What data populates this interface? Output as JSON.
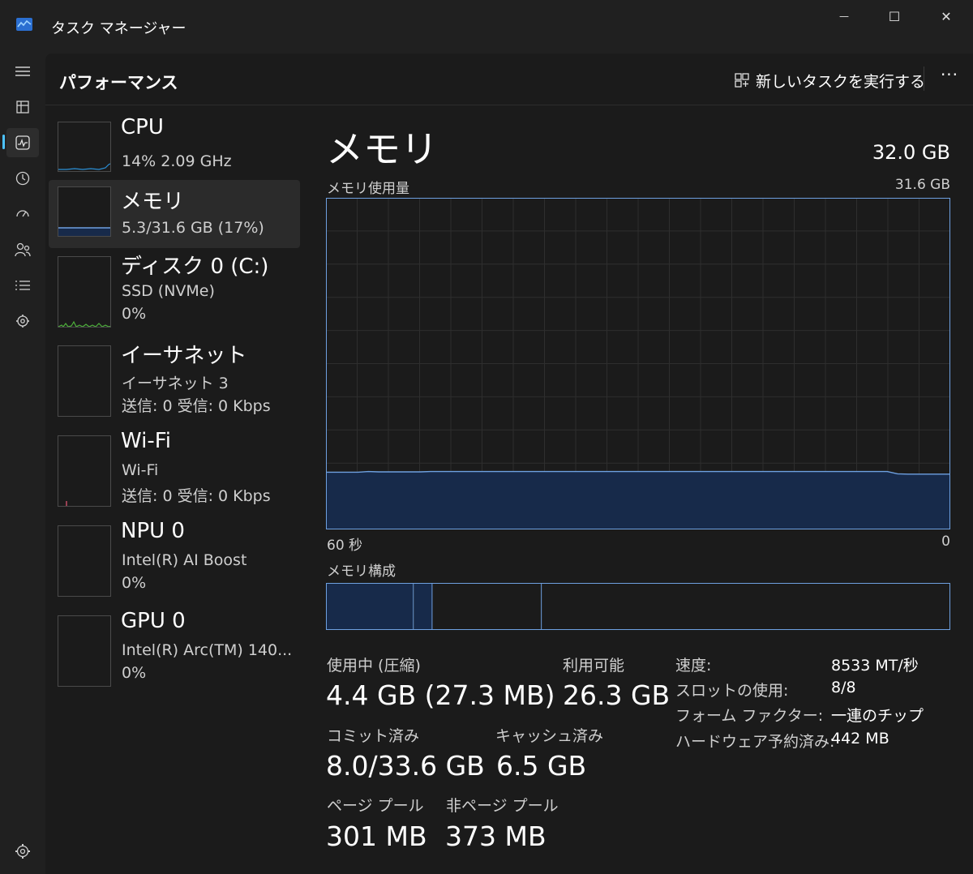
{
  "app": {
    "title": "タスク マネージャー"
  },
  "window_controls": {
    "minimize": "—",
    "maximize": "☐",
    "close": "✕"
  },
  "nav": {
    "items": [
      {
        "name": "menu-icon"
      },
      {
        "name": "processes-icon"
      },
      {
        "name": "performance-icon",
        "active": true
      },
      {
        "name": "app-history-icon"
      },
      {
        "name": "startup-apps-icon"
      },
      {
        "name": "users-icon"
      },
      {
        "name": "details-icon"
      },
      {
        "name": "services-icon"
      }
    ],
    "settings_icon": "settings-icon"
  },
  "header": {
    "title": "パフォーマンス",
    "run_task_label": "新しいタスクを実行する",
    "more_label": "···"
  },
  "resources": [
    {
      "name": "CPU",
      "sub1": "14% 2.09 GHz",
      "sub2": ""
    },
    {
      "name": "メモリ",
      "sub1": "5.3/31.6 GB (17%)",
      "sub2": "",
      "selected": true
    },
    {
      "name": "ディスク 0 (C:)",
      "sub1": "SSD (NVMe)",
      "sub2": "0%"
    },
    {
      "name": "イーサネット",
      "sub1": "イーサネット 3",
      "sub2": "送信: 0 受信: 0 Kbps"
    },
    {
      "name": "Wi-Fi",
      "sub1": "Wi-Fi",
      "sub2": "送信: 0 受信: 0 Kbps"
    },
    {
      "name": "NPU 0",
      "sub1": "Intel(R) AI Boost",
      "sub2": "0%"
    },
    {
      "name": "GPU 0",
      "sub1": "Intel(R) Arc(TM) 140...",
      "sub2": "0%"
    }
  ],
  "detail": {
    "title": "メモリ",
    "total": "32.0 GB",
    "usage_label": "メモリ使用量",
    "usage_max": "31.6 GB",
    "axis_left": "60 秒",
    "axis_right": "0",
    "composition_label": "メモリ構成",
    "stats": {
      "in_use_label": "使用中 (圧縮)",
      "in_use_value": "4.4 GB (27.3 MB)",
      "available_label": "利用可能",
      "available_value": "26.3 GB",
      "committed_label": "コミット済み",
      "committed_value": "8.0/33.6 GB",
      "cached_label": "キャッシュ済み",
      "cached_value": "6.5 GB",
      "paged_label": "ページ プール",
      "paged_value": "301 MB",
      "nonpaged_label": "非ページ プール",
      "nonpaged_value": "373 MB"
    },
    "properties": [
      {
        "label": "速度:",
        "value": "8533 MT/秒"
      },
      {
        "label": "スロットの使用:",
        "value": "8/8"
      },
      {
        "label": "フォーム ファクター:",
        "value": "一連のチップ"
      },
      {
        "label": "ハードウェア予約済み:",
        "value": "442 MB"
      }
    ]
  },
  "chart_data": {
    "type": "area",
    "title": "メモリ使用量",
    "x_range_seconds": [
      60,
      0
    ],
    "ylim": [
      0,
      31.6
    ],
    "unit": "GB",
    "values_percent": [
      17.1,
      17.1,
      17.1,
      17.1,
      17.3,
      17.2,
      17.2,
      17.2,
      17.2,
      17.2,
      17.3,
      17.3,
      17.3,
      17.3,
      17.3,
      17.3,
      17.3,
      17.3,
      17.3,
      17.3,
      17.3,
      17.3,
      17.3,
      17.3,
      17.3,
      17.3,
      17.3,
      17.3,
      17.3,
      17.3,
      17.3,
      17.3,
      17.3,
      17.3,
      17.3,
      17.3,
      17.3,
      17.3,
      17.3,
      17.3,
      17.3,
      17.3,
      17.3,
      17.3,
      17.3,
      17.3,
      17.3,
      17.3,
      17.3,
      17.3,
      17.3,
      17.3,
      17.3,
      17.3,
      17.3,
      16.6,
      16.5,
      16.5,
      16.5,
      16.5,
      16.5
    ],
    "grid": true,
    "line_color": "#6ea0e0",
    "fill_color": "#172a4a"
  },
  "composition": {
    "segments": [
      {
        "name": "in-use",
        "fraction": 0.14,
        "filled": true
      },
      {
        "name": "modified",
        "fraction": 0.03,
        "filled": true
      },
      {
        "name": "standby",
        "fraction": 0.175,
        "filled": false
      },
      {
        "name": "free",
        "fraction": 0.655,
        "filled": false
      }
    ]
  },
  "colors": {
    "accent": "#4cc2ff",
    "memory_line": "#6ea0e0",
    "memory_fill": "#172a4a",
    "cpu_line": "#2a8fd6",
    "disk_line": "#4caf3a",
    "wifi_mark": "#d0506a"
  }
}
